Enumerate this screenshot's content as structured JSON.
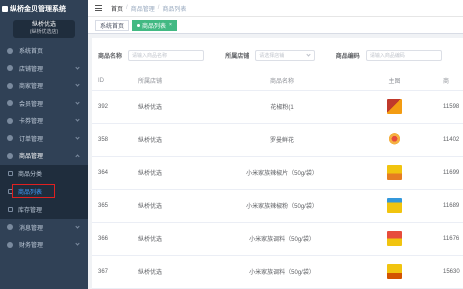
{
  "sidebar": {
    "title": "纵桥金贝管理系统",
    "store_name": "纵桥优选",
    "store_sub": "(纵桥优选店)",
    "items": [
      {
        "label": "系统首页"
      },
      {
        "label": "店铺管理"
      },
      {
        "label": "商家管理"
      },
      {
        "label": "会员管理"
      },
      {
        "label": "卡券管理"
      },
      {
        "label": "订单管理"
      },
      {
        "label": "商品管理"
      }
    ],
    "sub_items": [
      {
        "label": "商品分类"
      },
      {
        "label": "商品列表"
      },
      {
        "label": "库存管理"
      }
    ],
    "items_after": [
      {
        "label": "消息管理"
      },
      {
        "label": "财务管理"
      }
    ]
  },
  "topbar": {
    "crumbs": [
      "首页",
      "商品管理",
      "商品列表"
    ]
  },
  "tags": [
    {
      "label": "系统首页"
    },
    {
      "label": "商品列表"
    }
  ],
  "filters": {
    "name_label": "商品名称",
    "name_placeholder": "请输入商品名称",
    "owner_label": "所属店铺",
    "owner_placeholder": "请选择店铺",
    "code_label": "商品编码",
    "code_placeholder": "请输入商品编码"
  },
  "table": {
    "headers": [
      "ID",
      "所属店铺",
      "商品名称",
      "主图",
      "商"
    ],
    "rows": [
      {
        "id": "392",
        "store": "纵桥优选",
        "name": "花椒粉(1",
        "code": "11598"
      },
      {
        "id": "358",
        "store": "纵桥优选",
        "name": "罗曼鲜花",
        "code": "11402"
      },
      {
        "id": "364",
        "store": "纵桥优选",
        "name": "小米家族辣椒片（50g/袋）",
        "code": "11699"
      },
      {
        "id": "365",
        "store": "纵桥优选",
        "name": "小米家族辣椒粉（50g/袋）",
        "code": "11689"
      },
      {
        "id": "366",
        "store": "纵桥优选",
        "name": "小米家族调料（50g/袋）",
        "code": "11676"
      },
      {
        "id": "367",
        "store": "纵桥优选",
        "name": "小米家族调料（50g/袋）",
        "code": "15630"
      }
    ]
  },
  "colors": {
    "sidebar_bg": "#304156",
    "active_tag": "#42b983",
    "active_link": "#409eff",
    "highlight_box": "#e02020"
  }
}
